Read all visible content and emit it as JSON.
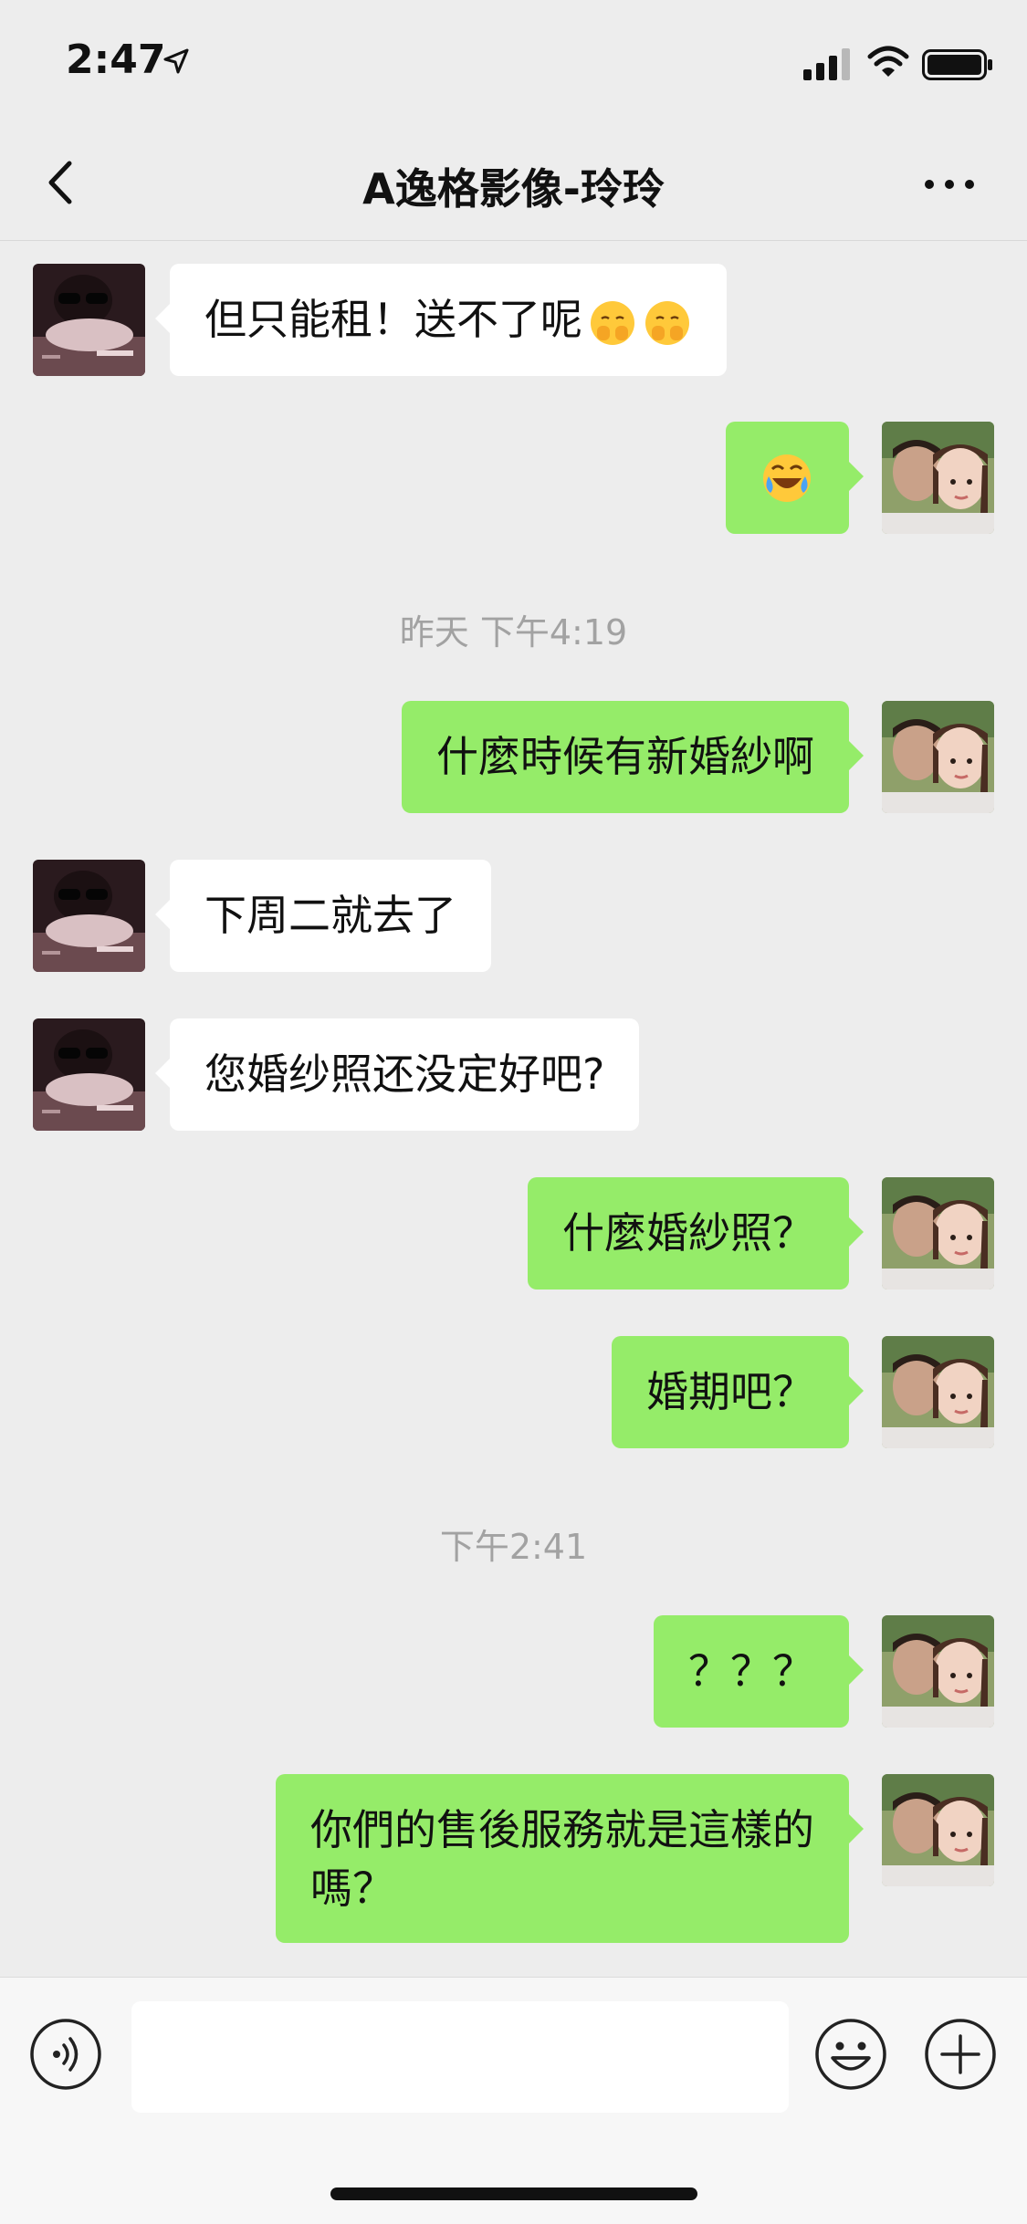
{
  "status_bar": {
    "time": "2:47"
  },
  "header": {
    "title": "A逸格影像-玲玲"
  },
  "messages": [
    {
      "side": "left",
      "text": "但只能租！送不了呢",
      "emojis": [
        "hand-over-mouth-emoji",
        "hand-over-mouth-emoji"
      ]
    },
    {
      "side": "right",
      "text": "",
      "emojis": [
        "rolling-on-floor-laughing-emoji"
      ]
    },
    {
      "type": "timestamp",
      "text": "昨天 下午4:19"
    },
    {
      "side": "right",
      "text": "什麼時候有新婚紗啊"
    },
    {
      "side": "left",
      "text": "下周二就去了"
    },
    {
      "side": "left",
      "text": "您婚纱照还没定好吧?"
    },
    {
      "side": "right",
      "text": "什麼婚紗照？"
    },
    {
      "side": "right",
      "text": "婚期吧？"
    },
    {
      "type": "timestamp",
      "text": "下午2:41"
    },
    {
      "side": "right",
      "text": "？？？"
    },
    {
      "side": "right",
      "text_line1": "你們的售後服務就是這樣的",
      "text_line2": "嗎？"
    }
  ],
  "input_bar": {
    "placeholder": ""
  },
  "colors": {
    "sent_bubble": "#95ec69",
    "received_bubble": "#ffffff",
    "background": "#ededed"
  }
}
